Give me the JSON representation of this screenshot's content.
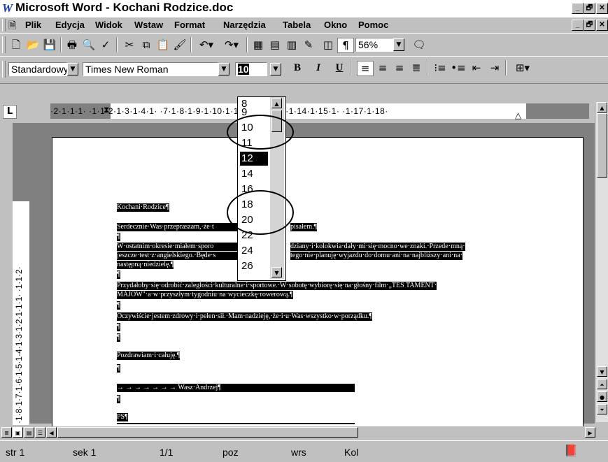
{
  "window": {
    "title": "Microsoft Word - Kochani Rodzice.doc",
    "app_icon": "W",
    "buttons": [
      "_",
      "🗗",
      "✕"
    ]
  },
  "menu": {
    "items": [
      "Plik",
      "Edycja",
      "Widok",
      "Wstaw",
      "Format",
      "Narzędzia",
      "Tabela",
      "Okno",
      "Pomoc"
    ]
  },
  "standard_toolbar": {
    "zoom": "56%"
  },
  "format_toolbar": {
    "style": "Standardowy",
    "font": "Times New Roman",
    "size": "10",
    "bold": "B",
    "italic": "I",
    "underline": "U"
  },
  "ruler": {
    "text": "·2·1·1·1·  ·1·1·2·1·3·1·4·1·                 ·7·1·8·1·9·1·10·1·11·1·12·1·13·1·14·1·15·1·  ·1·17·1·18·",
    "tab_marker": "L"
  },
  "vertical_ruler": {
    "text": "·1·8·1·7·1·6·1·5·1·4·1·3·1·2·1·1·1·  ·1·1·2·"
  },
  "font_size_list": {
    "options": [
      "8",
      "9",
      "10",
      "11",
      "12",
      "14",
      "16",
      "18",
      "20",
      "22",
      "24",
      "26"
    ],
    "selected": "12"
  },
  "document": {
    "lines": [
      "Kochani·Rodzice¶",
      "Serdecznie·Was·przepraszam,·że·t",
      "pisałem.¶",
      "¶",
      "W·ostatnim·okresie·miałem·sporo",
      "dziany·i·kolokwia·dały·mi·się·mocno·we·znaki.·Przede·mną·",
      "jeszcze·test·z·angielskiego.·Będe·s",
      "tego·nie·planuję·wyjazdu·do·domu·ani·na·najbliższy·ani·na·",
      "następną·niedzielę.¶",
      "¶",
      "Przydałoby·się·odrobić·zaległości·kulturalne·i·sportowe.·W·sobotę·wybiorę·się·na·głośny·film·„TES TAMENT·",
      "MAJOW\"·a·w·przyszłym·tygodniu·na·wycieczkę·rowerową.¶",
      "¶",
      "Oczywiście·jestem·zdrowy·i·pełen·sił.·Mam·nadzieję,·że·i·u·Was·wszystko·w·porządku.¶",
      "¶",
      "¶",
      "Pozdrawiam·i·całuję.¶",
      "¶",
      "→ → → → → → → Wasz·Andrzej¶",
      "¶",
      "PS¶"
    ]
  },
  "status": {
    "page": "str 1",
    "section": "sek 1",
    "pages": "1/1",
    "pos": "poz",
    "line": "wrs",
    "col": "Kol"
  }
}
